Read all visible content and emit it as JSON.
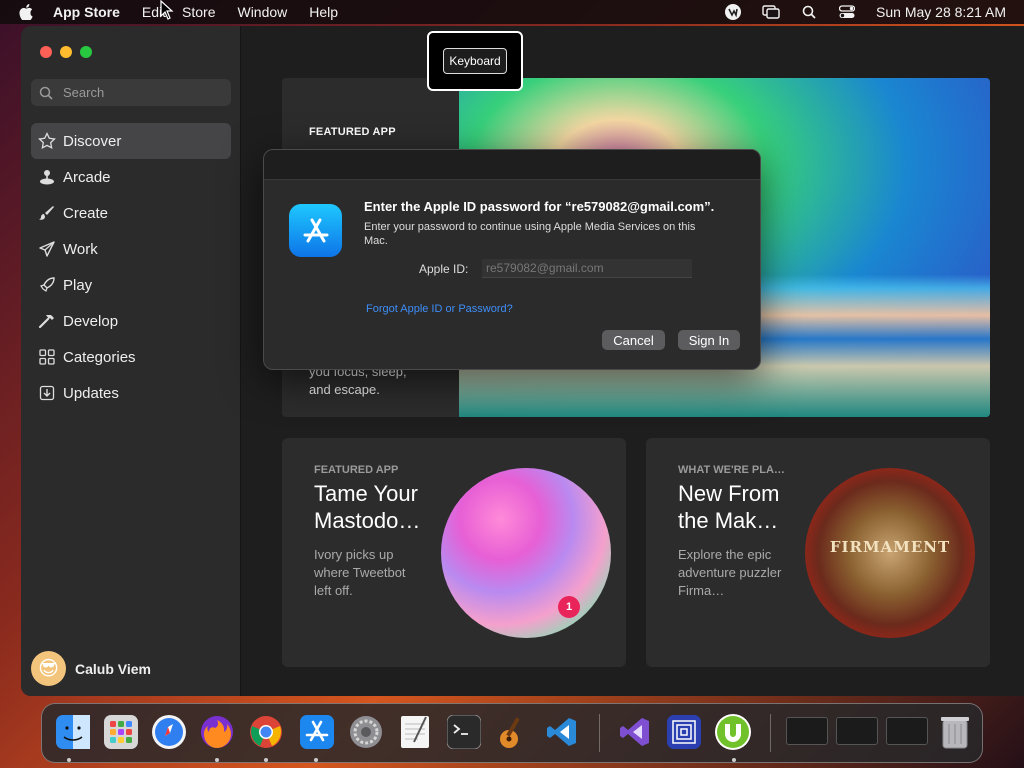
{
  "menubar": {
    "app_name": "App Store",
    "menus": [
      "Edit",
      "Store",
      "Window",
      "Help"
    ],
    "clock": "Sun May 28  8:21 AM"
  },
  "sidebar": {
    "search_placeholder": "Search",
    "items": [
      {
        "label": "Discover",
        "icon": "star-icon",
        "active": true
      },
      {
        "label": "Arcade",
        "icon": "joystick-icon"
      },
      {
        "label": "Create",
        "icon": "brush-icon"
      },
      {
        "label": "Work",
        "icon": "paper-plane-icon"
      },
      {
        "label": "Play",
        "icon": "rocket-icon"
      },
      {
        "label": "Develop",
        "icon": "hammer-icon"
      },
      {
        "label": "Categories",
        "icon": "grid-icon"
      },
      {
        "label": "Updates",
        "icon": "download-icon"
      }
    ],
    "user_name": "Calub Viem"
  },
  "keyboard_hint": "Keyboard",
  "hero": {
    "label": "FEATURED APP",
    "desc": "you focus, sleep, and escape."
  },
  "cards": [
    {
      "eyebrow": "FEATURED APP",
      "title": "Tame Your Mastodo…",
      "desc": "Ivory picks up where Tweetbot left off.",
      "badge": "1"
    },
    {
      "eyebrow": "WHAT WE'RE PLA…",
      "title": "New From the Mak…",
      "desc": "Explore the epic adventure puzzler Firma…",
      "art_text": "FIRMAMENT"
    }
  ],
  "dialog": {
    "title": "Enter the Apple ID password for “re579082@gmail.com”.",
    "subtitle": "Enter your password to continue using Apple Media Services on this Mac.",
    "apple_id_label": "Apple ID:",
    "apple_id_value": "re579082@gmail.com",
    "forgot_link": "Forgot Apple ID or Password?",
    "cancel_label": "Cancel",
    "signin_label": "Sign In"
  },
  "dock": {
    "apps": [
      {
        "name": "Finder",
        "color": "#3b8ef0"
      },
      {
        "name": "Launchpad",
        "color": "#cfcfcf"
      },
      {
        "name": "Safari",
        "color": "#2f7ff0"
      },
      {
        "name": "Firefox",
        "color": "#ff7a1f"
      },
      {
        "name": "Chrome",
        "color": "#f1f1f1"
      },
      {
        "name": "App Store",
        "color": "#1d87f0"
      },
      {
        "name": "System Settings",
        "color": "#8e8e93"
      },
      {
        "name": "TextEdit",
        "color": "#f3f3f3"
      },
      {
        "name": "Terminal",
        "color": "#1f1f1f"
      },
      {
        "name": "GarageBand",
        "color": "#e1a244"
      },
      {
        "name": "VS Code",
        "color": "#2b8ad8"
      },
      {
        "name": "Visual Studio",
        "color": "#7f4fd2"
      },
      {
        "name": "Frame",
        "color": "#3b57d8"
      },
      {
        "name": "uTorrent",
        "color": "#71c12a"
      }
    ]
  }
}
